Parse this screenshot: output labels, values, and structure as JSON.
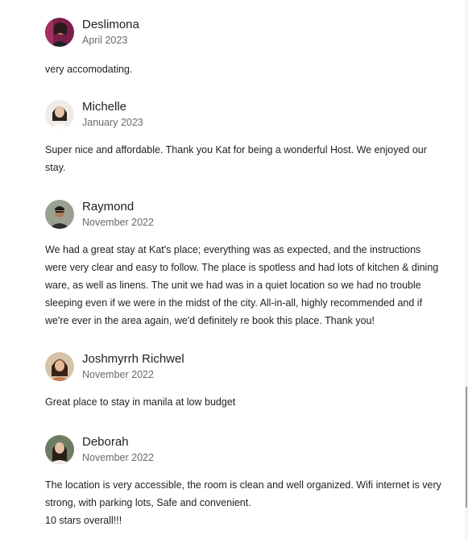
{
  "reviews": [
    {
      "name": "Deslimona",
      "date": "April 2023",
      "text": "very accomodating.",
      "avatar": "avatar-photo-deslimona",
      "avatar_bg": "#7a1f4a"
    },
    {
      "name": "Michelle",
      "date": "January 2023",
      "text": "Super nice and affordable. Thank you Kat for being a wonderful Host. We enjoyed our\nstay.",
      "avatar": "avatar-photo-michelle",
      "avatar_bg": "#e9e6e2"
    },
    {
      "name": "Raymond",
      "date": "November 2022",
      "text": "We had a great stay at Kat's place; everything was as expected, and the instructions\nwere very clear and easy to follow. The place is spotless and had lots of kitchen & dining\nware, as well as linens. The unit we had was in a quiet location so we had no trouble\nsleeping even if we were in the midst of the city. All-in-all, highly recommended and if\nwe're ever in the area again, we'd definitely re book this place. Thank you!",
      "avatar": "avatar-photo-raymond",
      "avatar_bg": "#8a8f86"
    },
    {
      "name": "Joshmyrrh Richwel",
      "date": "November 2022",
      "text": "Great place to stay in manila at low budget",
      "avatar": "avatar-photo-joshmyrrh",
      "avatar_bg": "#c9b49a"
    },
    {
      "name": "Deborah",
      "date": "November 2022",
      "text": "The location is very accessible, the room is clean and well organized. Wifi internet is very\nstrong, with parking lots, Safe and convenient.\n10 stars overall!!!",
      "avatar": "avatar-photo-deborah",
      "avatar_bg": "#5d6e55"
    }
  ]
}
